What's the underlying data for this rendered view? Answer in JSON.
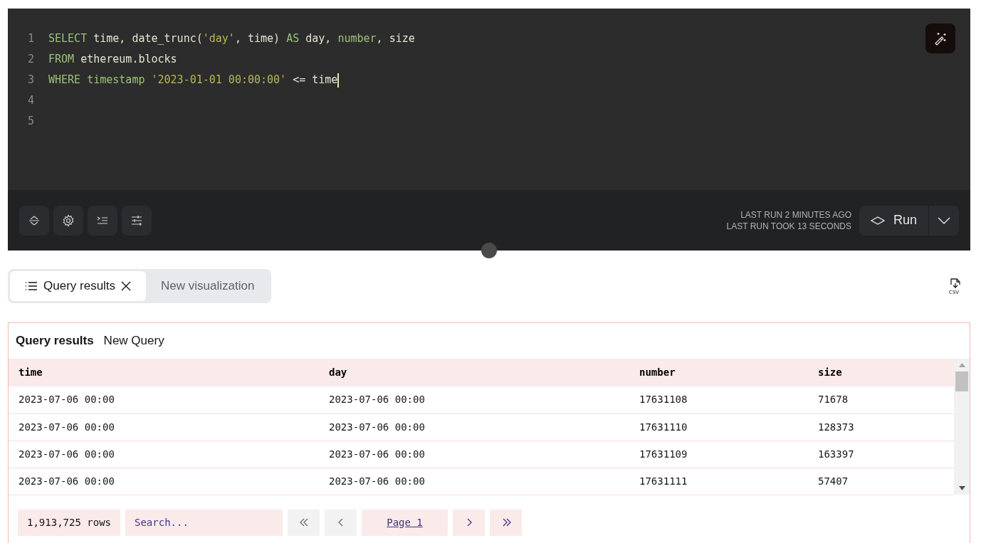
{
  "editor": {
    "lines": [
      {
        "number": "1",
        "tokens": [
          {
            "kind": "keyword",
            "text": "SELECT"
          },
          {
            "kind": "plain",
            "text": " time, date_trunc("
          },
          {
            "kind": "string",
            "text": "'day'"
          },
          {
            "kind": "plain",
            "text": ", time) "
          },
          {
            "kind": "keyword",
            "text": "AS"
          },
          {
            "kind": "plain",
            "text": " day, "
          },
          {
            "kind": "keyword",
            "text": "number"
          },
          {
            "kind": "plain",
            "text": ", size"
          }
        ]
      },
      {
        "number": "2",
        "tokens": [
          {
            "kind": "keyword",
            "text": "FROM"
          },
          {
            "kind": "plain",
            "text": " ethereum.blocks"
          }
        ]
      },
      {
        "number": "3",
        "tokens": [
          {
            "kind": "keyword",
            "text": "WHERE timestamp"
          },
          {
            "kind": "string",
            "text": " '2023-01-01 00:00:00'"
          },
          {
            "kind": "plain",
            "text": " <= time"
          }
        ],
        "cursor": true
      },
      {
        "number": "4"
      },
      {
        "number": "5"
      }
    ]
  },
  "export": {
    "label": "CSV"
  },
  "toolbar": {
    "status": [
      "LAST RUN 2 MINUTES AGO",
      "LAST RUN TOOK 13 SECONDS"
    ],
    "run_label": "Run"
  },
  "tabs": [
    {
      "label": "Query results",
      "selected": true
    },
    {
      "label": "New visualization",
      "selected": false
    }
  ],
  "results": {
    "title": "Query results",
    "subtitle": "New Query",
    "columns": [
      "time",
      "day",
      "number",
      "size"
    ],
    "rows": [
      [
        "2023-07-06 00:00",
        "2023-07-06 00:00",
        "17631108",
        "71678"
      ],
      [
        "2023-07-06 00:00",
        "2023-07-06 00:00",
        "17631110",
        "128373"
      ],
      [
        "2023-07-06 00:00",
        "2023-07-06 00:00",
        "17631109",
        "163397"
      ],
      [
        "2023-07-06 00:00",
        "2023-07-06 00:00",
        "17631111",
        "57407"
      ]
    ],
    "row_count": "1,913,725 rows",
    "search": {
      "placeholder": "Search..."
    },
    "pager": [
      {
        "kind": "first",
        "disabled": true
      },
      {
        "kind": "prev",
        "disabled": true
      },
      {
        "kind": "page",
        "label": "Page 1"
      },
      {
        "kind": "next",
        "disabled": false
      },
      {
        "kind": "last",
        "disabled": false
      }
    ]
  }
}
